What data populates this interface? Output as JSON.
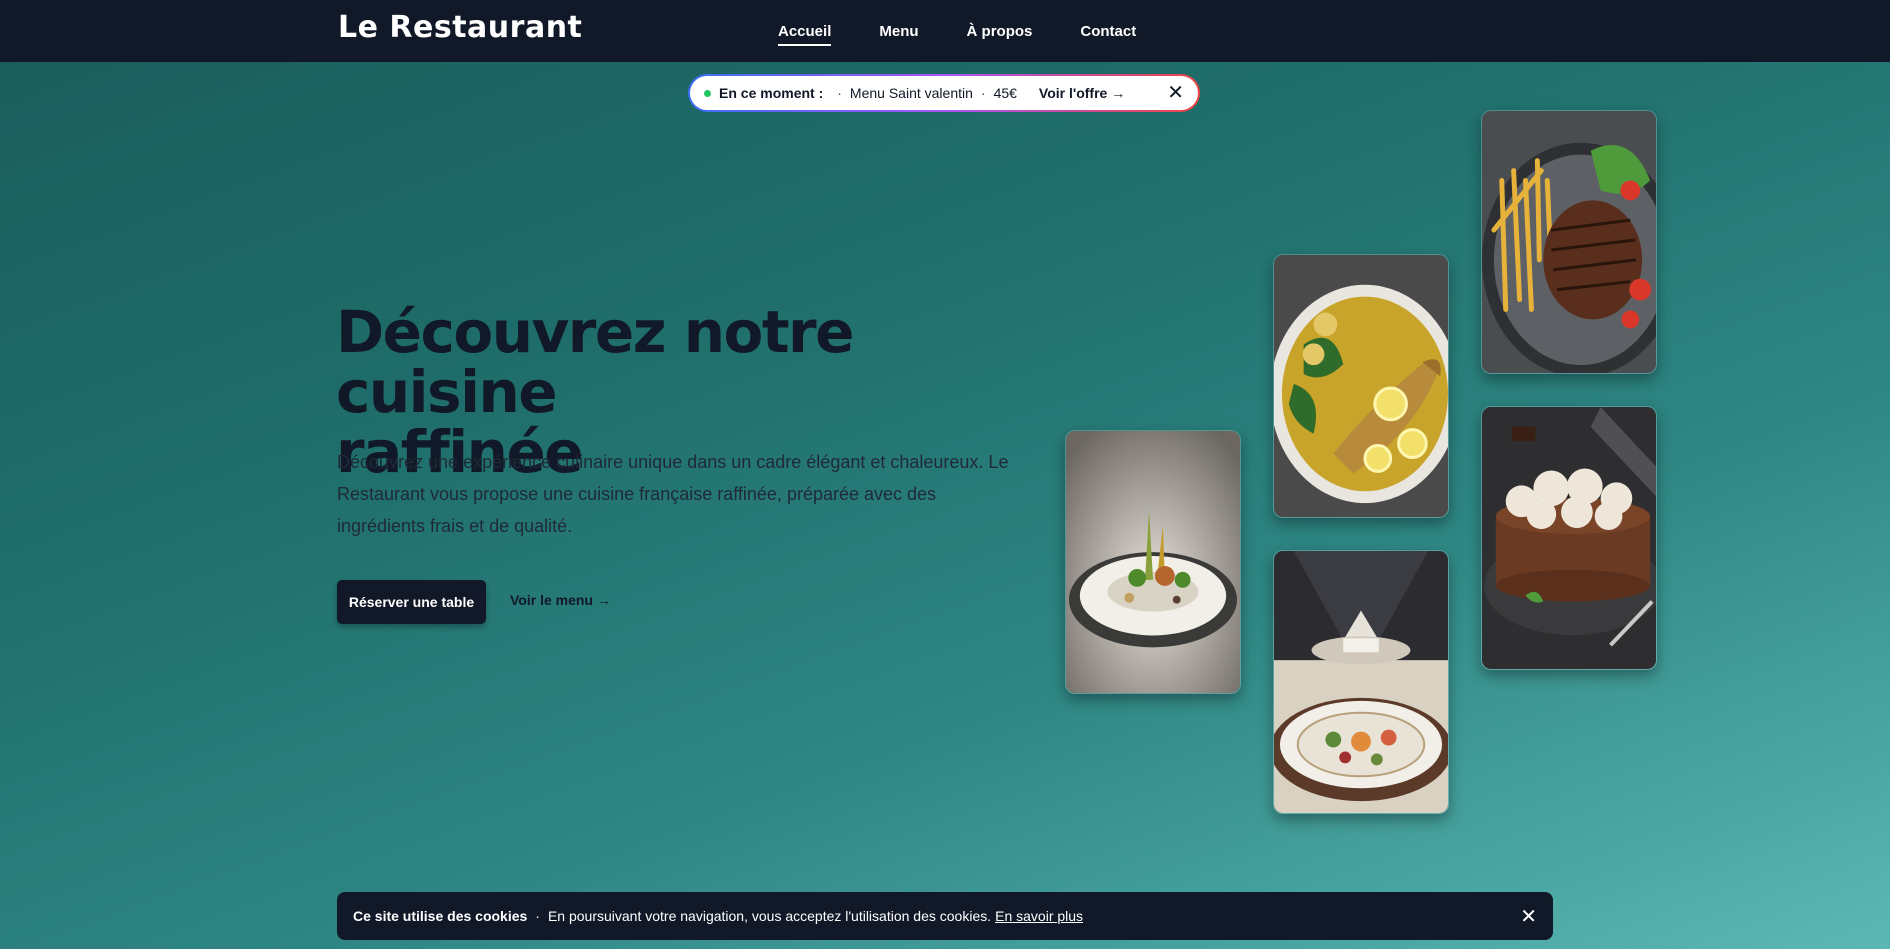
{
  "brand": {
    "name": "Le Restaurant"
  },
  "nav": {
    "items": [
      {
        "label": "Accueil",
        "active": true
      },
      {
        "label": "Menu",
        "active": false
      },
      {
        "label": "À propos",
        "active": false
      },
      {
        "label": "Contact",
        "active": false
      }
    ]
  },
  "announcement": {
    "title": "En ce moment :",
    "separator": "·",
    "item": "Menu Saint valentin",
    "price": "45€",
    "cta": "Voir l'offre →",
    "close": "✕"
  },
  "hero": {
    "title_line1": "Découvrez notre cuisine",
    "title_line2": "raffinée",
    "description": "Découvrez une expérience culinaire unique dans un cadre élégant et chaleureux. Le Restaurant vous propose une cuisine française raffinée, préparée avec des ingrédients frais et de qualité.",
    "primary_button": "Réserver une table",
    "secondary_link": "Voir le menu →"
  },
  "images": [
    {
      "name": "gastronomic-plate-image"
    },
    {
      "name": "grilled-fish-image"
    },
    {
      "name": "fine-dining-table-image"
    },
    {
      "name": "steak-fries-image"
    },
    {
      "name": "chocolate-cake-image"
    }
  ],
  "cookie": {
    "title": "Ce site utilise des cookies",
    "separator": "·",
    "text": "En poursuivant votre navigation, vous acceptez l'utilisation des cookies.",
    "link": "En savoir plus",
    "close": "✕"
  },
  "colors": {
    "navbar": "#111827",
    "accent_dot": "#22c55e",
    "gradient_start": "#1a5c5a",
    "gradient_end": "#5bb8b3"
  }
}
